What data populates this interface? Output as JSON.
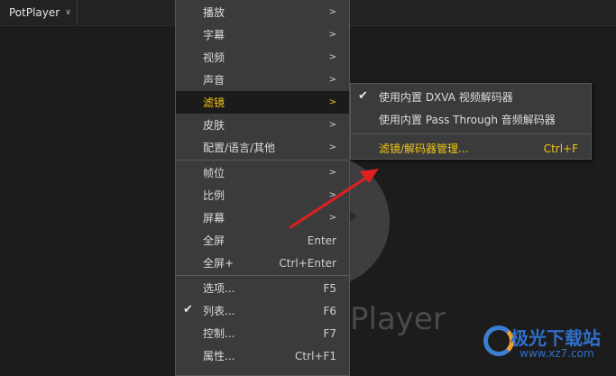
{
  "app": {
    "title": "PotPlayer"
  },
  "logo": {
    "text": "Player"
  },
  "menu": {
    "groups": [
      [
        {
          "label": "播放",
          "arrow": ">"
        },
        {
          "label": "字幕",
          "arrow": ">"
        },
        {
          "label": "视频",
          "arrow": ">"
        },
        {
          "label": "声音",
          "arrow": ">"
        },
        {
          "label": "滤镜",
          "arrow": ">",
          "active": true
        },
        {
          "label": "皮肤",
          "arrow": ">"
        },
        {
          "label": "配置/语言/其他",
          "arrow": ">"
        }
      ],
      [
        {
          "label": "帧位",
          "arrow": ">"
        },
        {
          "label": "比例",
          "arrow": ">"
        },
        {
          "label": "屏幕",
          "arrow": ">"
        },
        {
          "label": "全屏",
          "shortcut": "Enter"
        },
        {
          "label": "全屏+",
          "shortcut": "Ctrl+Enter"
        }
      ],
      [
        {
          "label": "选项...",
          "shortcut": "F5"
        },
        {
          "label": "列表...",
          "shortcut": "F6",
          "checked": true
        },
        {
          "label": "控制...",
          "shortcut": "F7"
        },
        {
          "label": "属性...",
          "shortcut": "Ctrl+F1"
        }
      ]
    ]
  },
  "submenu": {
    "items": [
      {
        "label": "使用内置 DXVA 视频解码器",
        "checked": true
      },
      {
        "label": "使用内置 Pass Through 音频解码器"
      }
    ],
    "manage": {
      "label": "滤镜/解码器管理...",
      "shortcut": "Ctrl+F"
    }
  },
  "watermark": {
    "brand": "极光下载站",
    "url": "www.xz7.com"
  },
  "colors": {
    "highlight": "#f0c419",
    "menu_bg": "#3b3b3b",
    "annotation": "#e02020"
  }
}
